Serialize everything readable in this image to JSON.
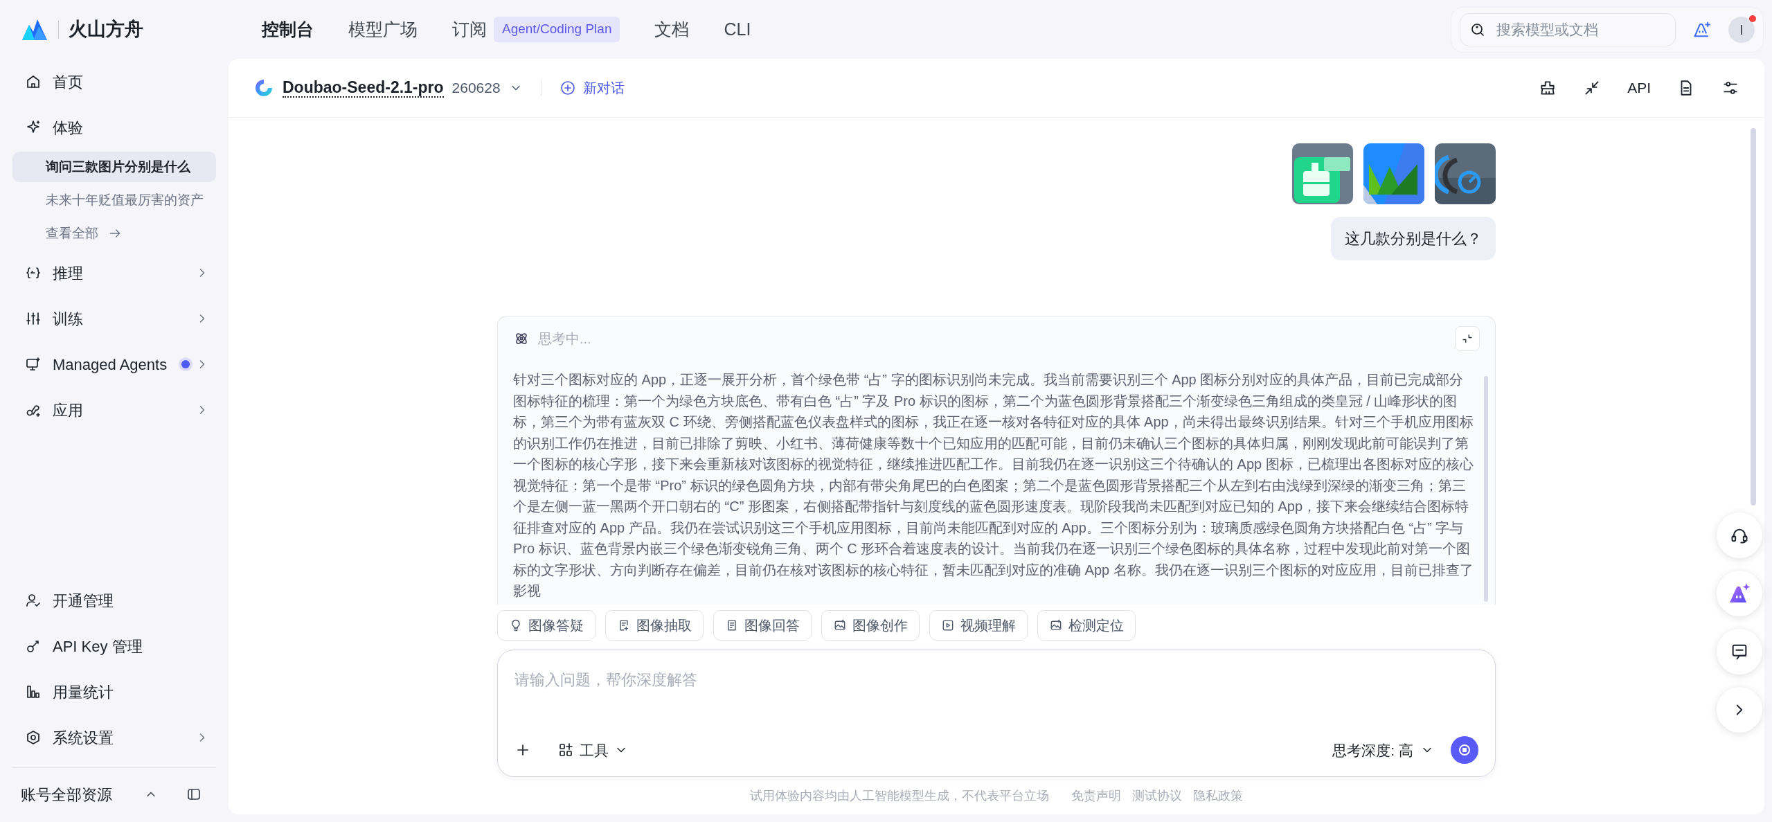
{
  "brand": {
    "name": "火山方舟"
  },
  "nav": [
    {
      "label": "控制台",
      "selected": true
    },
    {
      "label": "模型广场",
      "selected": false
    },
    {
      "label": "订阅",
      "selected": false,
      "badge": "Agent/Coding Plan"
    },
    {
      "label": "文档",
      "selected": false
    },
    {
      "label": "CLI",
      "selected": false
    }
  ],
  "search": {
    "placeholder": "搜索模型或文档"
  },
  "user": {
    "initial": "I",
    "notification": true
  },
  "sidebar": {
    "items": [
      {
        "label": "首页",
        "has_submenu": false
      },
      {
        "label": "体验",
        "has_submenu": false,
        "children": [
          {
            "label": "询问三款图片分别是什么",
            "selected": true
          },
          {
            "label": "未来十年贬值最厉害的资产",
            "selected": false
          }
        ],
        "view_all": "查看全部"
      },
      {
        "label": "推理",
        "has_submenu": true
      },
      {
        "label": "训练",
        "has_submenu": true
      },
      {
        "label": "Managed Agents",
        "has_submenu": true,
        "dot": true
      },
      {
        "label": "应用",
        "has_submenu": true
      }
    ],
    "bottom_items": [
      {
        "label": "开通管理",
        "has_submenu": false
      },
      {
        "label": "API Key 管理",
        "has_submenu": false
      },
      {
        "label": "用量统计",
        "has_submenu": false
      },
      {
        "label": "系统设置",
        "has_submenu": true
      }
    ],
    "account": {
      "label": "账号全部资源",
      "expanded": true
    }
  },
  "header": {
    "model": "Doubao-Seed-2.1-pro",
    "version": "260628",
    "new_chat": "新对话",
    "api": "API"
  },
  "conversation": {
    "user_message": "这几款分别是什么？",
    "thinking": {
      "status": "思考中...",
      "expanded": true,
      "text": "针对三个图标对应的 App，正逐一展开分析，首个绿色带 “占” 字的图标识别尚未完成。我当前需要识别三个 App 图标分别对应的具体产品，目前已完成部分图标特征的梳理：第一个为绿色方块底色、带有白色 “占” 字及 Pro 标识的图标，第二个为蓝色圆形背景搭配三个渐变绿色三角组成的类皇冠 / 山峰形状的图标，第三个为带有蓝灰双 C 环绕、旁侧搭配蓝色仪表盘样式的图标，我正在逐一核对各特征对应的具体 App，尚未得出最终识别结果。针对三个手机应用图标的识别工作仍在推进，目前已排除了剪映、小红书、薄荷健康等数十个已知应用的匹配可能，目前仍未确认三个图标的具体归属，刚刚发现此前可能误判了第一个图标的核心字形，接下来会重新核对该图标的视觉特征，继续推进匹配工作。目前我仍在逐一识别这三个待确认的 App 图标，已梳理出各图标对应的核心视觉特征：第一个是带 “Pro” 标识的绿色圆角方块，内部有带尖角尾巴的白色图案；第二个是蓝色圆形背景搭配三个从左到右由浅绿到深绿的渐变三角；第三个是左侧一蓝一黑两个开口朝右的 “C” 形图案，右侧搭配带指针与刻度线的蓝色圆形速度表。现阶段我尚未匹配到对应已知的 App，接下来会继续结合图标特征排查对应的 App 产品。我仍在尝试识别这三个手机应用图标，目前尚未能匹配到对应的 App。三个图标分别为：玻璃质感绿色圆角方块搭配白色 “占” 字与 Pro 标识、蓝色背景内嵌三个绿色渐变锐角三角、两个 C 形环合着速度表的设计。当前我仍在逐一识别三个绿色图标的具体名称，过程中发现此前对第一个图标的文字形状、方向判断存在偏差，目前仍在核对该图标的核心特征，暂未匹配到对应的准确 App 名称。我仍在逐一识别三个图标的对应应用，目前已排查了影视"
    }
  },
  "chips": [
    "图像答疑",
    "图像抽取",
    "图像回答",
    "图像创作",
    "视频理解",
    "检测定位"
  ],
  "composer": {
    "placeholder": "请输入问题，帮你深度解答",
    "tools": "工具",
    "depth": "思考深度: 高",
    "generating": true
  },
  "footer": {
    "disclaimer": "试用体验内容均由人工智能模型生成，不代表平台立场",
    "links": [
      "免责声明",
      "测试协议",
      "隐私政策"
    ]
  }
}
